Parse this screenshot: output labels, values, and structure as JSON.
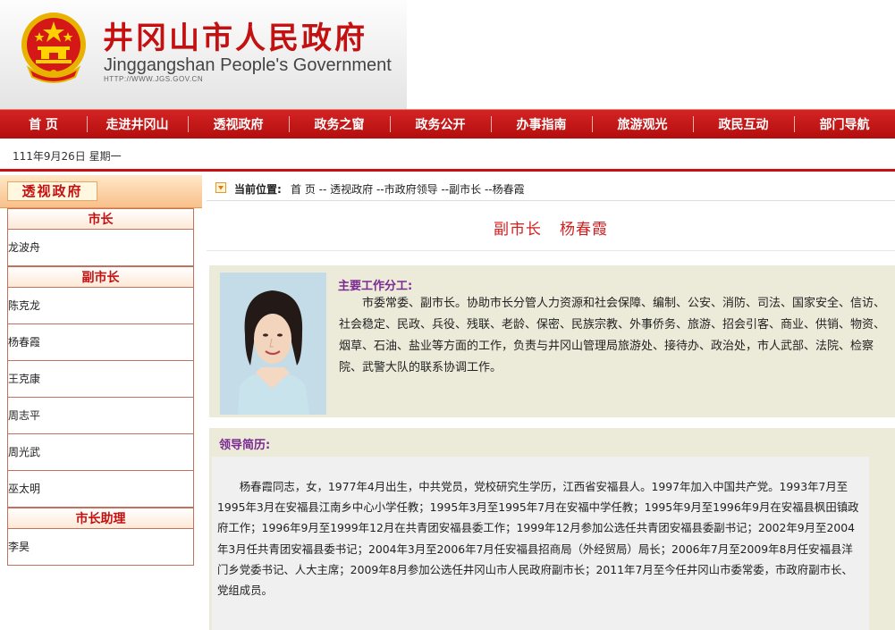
{
  "header": {
    "title": "井冈山市人民政府",
    "subtitle": "Jinggangshan People's Government",
    "url": "HTTP://WWW.JGS.GOV.CN"
  },
  "nav": {
    "items": [
      "首 页",
      "走进井冈山",
      "透视政府",
      "政务之窗",
      "政务公开",
      "办事指南",
      "旅游观光",
      "政民互动",
      "部门导航"
    ]
  },
  "datebar": {
    "date": "111年9月26日 星期一"
  },
  "sidebar": {
    "title": "透视政府",
    "sections": [
      {
        "header": "市长",
        "items": [
          "龙波舟"
        ]
      },
      {
        "header": "副市长",
        "items": [
          "陈克龙",
          "杨春霞",
          "王克康",
          "周志平",
          "周光武",
          "巫太明"
        ]
      },
      {
        "header": "市长助理",
        "items": [
          "李昊"
        ]
      }
    ]
  },
  "breadcrumb": {
    "label": "当前位置:",
    "path": [
      "首 页",
      " -- ",
      "透视政府",
      " --",
      "市政府领导",
      " --",
      "副市长",
      " --",
      "杨春霞"
    ]
  },
  "page": {
    "position": "副市长",
    "name": "杨春霞"
  },
  "profile": {
    "duty_title": "主要工作分工:",
    "duty_text": "市委常委、副市长。协助市长分管人力资源和社会保障、编制、公安、消防、司法、国家安全、信访、社会稳定、民政、兵役、残联、老龄、保密、民族宗教、外事侨务、旅游、招会引客、商业、供销、物资、烟草、石油、盐业等方面的工作，负责与井冈山管理局旅游处、接待办、政治处，市人武部、法院、检察院、武警大队的联系协调工作。"
  },
  "bio": {
    "title": "领导简历:",
    "text": "杨春霞同志，女，1977年4月出生，中共党员，党校研究生学历，江西省安福县人。1997年加入中国共产党。1993年7月至1995年3月在安福县江南乡中心小学任教；1995年3月至1995年7月在安福中学任教；1995年9月至1996年9月在安福县枫田镇政府工作；1996年9月至1999年12月在共青团安福县委工作；1999年12月参加公选任共青团安福县委副书记；2002年9月至2004年3月任共青团安福县委书记；2004年3月至2006年7月任安福县招商局（外经贸局）局长；2006年7月至2009年8月任安福县洋门乡党委书记、人大主席；2009年8月参加公选任井冈山市人民政府副市长；2011年7月至今任井冈山市委常委，市政府副市长、党组成员。"
  },
  "colors": {
    "brand_red": "#c41010",
    "section_purple": "#7a2a92",
    "panel_beige": "#ecead9"
  },
  "icons": {
    "emblem": "national-emblem-icon",
    "breadcrumb": "arrow-down-icon"
  }
}
